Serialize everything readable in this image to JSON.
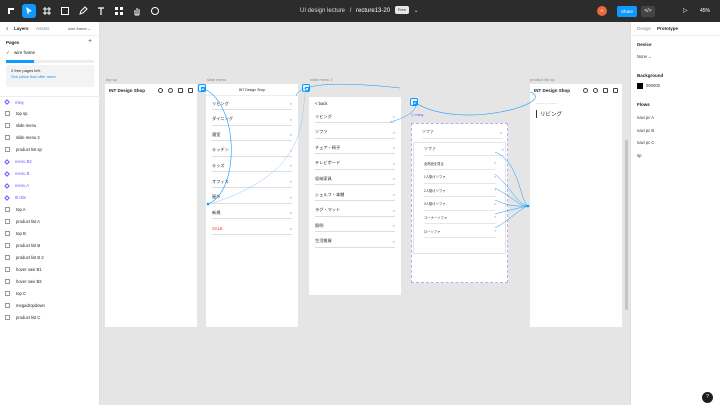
{
  "toolbar": {
    "file_name": "UI design lecture",
    "separator": "/",
    "page_name": "recture13-20",
    "badge": "Free",
    "avatar_initial": "H",
    "share_label": "Share",
    "code_label": "</>",
    "play_label": "▷",
    "zoom_label": "45%",
    "accent": "#0d99ff"
  },
  "left": {
    "tab_layers": "Layers",
    "tab_assets": "Assets",
    "current_page_select": "wire frame ⌄",
    "pages_heading": "Pages",
    "add_page": "+",
    "page": "wire frame",
    "note_text": "2 free pages left.",
    "note_link": "See plans that offer more",
    "layers": [
      {
        "name": "mlay",
        "type": "component"
      },
      {
        "name": "top sp",
        "type": "frame"
      },
      {
        "name": "slide menu",
        "type": "frame"
      },
      {
        "name": "slide menu 2",
        "type": "frame"
      },
      {
        "name": "product list sp",
        "type": "frame"
      },
      {
        "name": "menu B2",
        "type": "component"
      },
      {
        "name": "menu B",
        "type": "component"
      },
      {
        "name": "menu A",
        "type": "component"
      },
      {
        "name": "ttl title",
        "type": "component"
      },
      {
        "name": "top A",
        "type": "frame"
      },
      {
        "name": "product list A",
        "type": "frame"
      },
      {
        "name": "top B",
        "type": "frame"
      },
      {
        "name": "product list B",
        "type": "frame"
      },
      {
        "name": "product list B 2",
        "type": "frame"
      },
      {
        "name": "hover navi B1",
        "type": "frame"
      },
      {
        "name": "hover navi B2",
        "type": "frame"
      },
      {
        "name": "top C",
        "type": "frame"
      },
      {
        "name": "megadropdown",
        "type": "frame"
      },
      {
        "name": "product list C",
        "type": "frame"
      }
    ]
  },
  "canvas": {
    "frame_labels": {
      "top_sp": "top sp",
      "slide_menu": "slide menu",
      "slide_menu_2": "slide menu 2",
      "product_list_sp": "product list sp"
    },
    "shop_name": "INT Design Shop",
    "slide_menu_header": "INT Design Shop",
    "slide_menu_items": [
      "リビング",
      "ダイニング",
      "寝室",
      "キッチン",
      "キッズ",
      "オフィス",
      "屋外",
      "新規",
      "SALE"
    ],
    "slide_menu_2_back": "< back",
    "slide_menu_2_items": [
      "リビング",
      "ソファ",
      "チェア・椅子",
      "テレビボード",
      "収納家具",
      "シェルフ・本棚",
      "ラグ・マット",
      "照明",
      "生活雑貨"
    ],
    "mlay_tag": "mlay",
    "dropdown_top": "ソファ",
    "dropdown_head": "ソファ",
    "dropdown_items": [
      "全商品を見る",
      "1人掛けソファ",
      "2人掛けソファ",
      "3人掛けソファ",
      "コーナーソファ",
      "ローソファ"
    ],
    "product_list_breadcrumb": "ーーー・ーーー",
    "product_list_title": "リビング",
    "chevron": ">"
  },
  "right": {
    "tab_design": "Design",
    "tab_prototype": "Prototype",
    "device_heading": "Device",
    "device_value": "None ⌄",
    "background_heading": "Background",
    "background_hex": "000000",
    "background_color": "#000000",
    "flows_heading": "Flows",
    "flows": [
      "navi pc A",
      "navi pc B",
      "navi pc C",
      "sp"
    ]
  },
  "help_label": "?"
}
